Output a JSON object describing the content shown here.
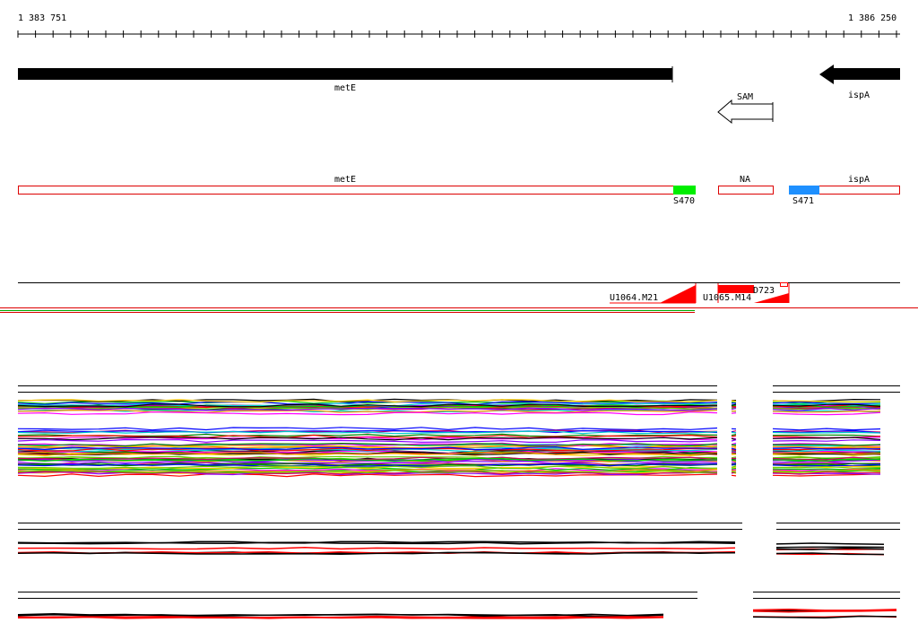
{
  "coords": {
    "start": "1 383 751",
    "end": "1 386 250"
  },
  "genes": [
    {
      "id": "metE",
      "label": "metE",
      "strand": "+"
    },
    {
      "id": "ispA",
      "label": "ispA",
      "strand": "-"
    },
    {
      "id": "SAM",
      "label": "SAM",
      "strand": "-"
    }
  ],
  "segments": [
    {
      "id": "metE",
      "label": "metE"
    },
    {
      "id": "NA",
      "label": "NA"
    },
    {
      "id": "ispA",
      "label": "ispA"
    }
  ],
  "markers": [
    {
      "id": "S470",
      "label": "S470",
      "color": "#00ee00"
    },
    {
      "id": "S471",
      "label": "S471",
      "color": "#1e90ff"
    }
  ],
  "features": [
    {
      "id": "U1064.M21",
      "label": "U1064.M21"
    },
    {
      "id": "U1065.M14",
      "label": "U1065.M14"
    },
    {
      "id": "D723",
      "label": "D723"
    }
  ],
  "colors": {
    "gene": "#000000",
    "segment_border": "#dd0000",
    "feature": "#ff0000",
    "palette": [
      "#ff0000",
      "#00cc00",
      "#0000ff",
      "#ff00ff",
      "#00cccc",
      "#ffcc00",
      "#000000",
      "#8800ff",
      "#ff8800",
      "#008800",
      "#cc0066",
      "#66cc00"
    ]
  }
}
